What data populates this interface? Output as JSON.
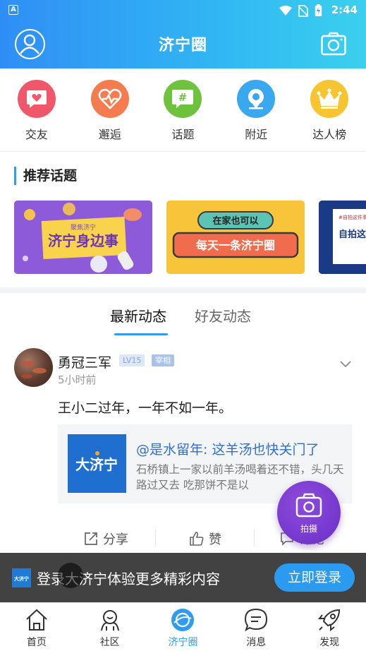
{
  "status_bar": {
    "time": "2:44"
  },
  "header": {
    "title": "济宁圈"
  },
  "quick_entries": [
    {
      "label": "交友",
      "color": "#f0576a"
    },
    {
      "label": "邂逅",
      "color": "#f57c4e"
    },
    {
      "label": "话题",
      "color": "#6fc23c"
    },
    {
      "label": "附近",
      "color": "#3aa8ee"
    },
    {
      "label": "达人榜",
      "color": "#f7c531"
    }
  ],
  "recommend": {
    "title": "推荐话题",
    "banners": [
      {
        "small": "聚焦济宁",
        "main": "济宁身边事"
      },
      {
        "small": "在家也可以",
        "main": "每天一条济宁圈"
      },
      {
        "small": "#自拍这件事",
        "main": "自拍这 万万不"
      }
    ]
  },
  "tabs": {
    "active": "最新动态",
    "inactive": "好友动态"
  },
  "post": {
    "author": "勇冠三军",
    "level": "LV15",
    "role": "宰相",
    "time": "5小时前",
    "text": "王小二过年，一年不如一年。",
    "quote": {
      "logo_text": "大济宁",
      "title": "@是水留年: 这羊汤也快关门了",
      "body": "石桥镇上一家以前羊汤喝着还不错，头几天路过又去 吃那饼不是以"
    },
    "actions": {
      "share": "分享",
      "like": "赞",
      "comment": "评论"
    }
  },
  "capture": {
    "label": "拍摄"
  },
  "login_bar": {
    "logo_text": "大济宁",
    "text": "登录大济宁体验更多精彩内容",
    "button": "立即登录"
  },
  "bottom_nav": [
    {
      "label": "首页"
    },
    {
      "label": "社区"
    },
    {
      "label": "济宁圈"
    },
    {
      "label": "消息"
    },
    {
      "label": "发现"
    }
  ],
  "colors": {
    "accent": "#2f9bf2",
    "capture": "#7a3bd3"
  }
}
